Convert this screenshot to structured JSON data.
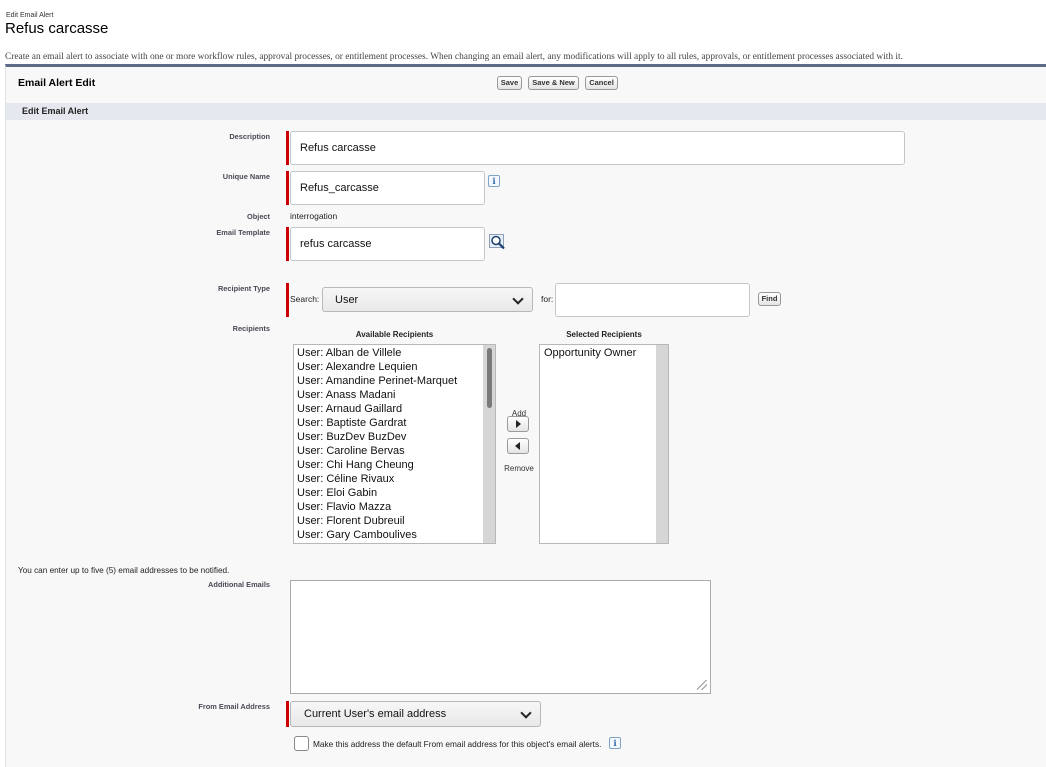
{
  "header": {
    "breadcrumb": "Edit Email Alert",
    "title": "Refus carcasse",
    "description": "Create an email alert to associate with one or more workflow rules, approval processes, or entitlement processes. When changing an email alert, any modifications will apply to all rules, approvals, or entitlement processes associated with it."
  },
  "panel": {
    "title": "Email Alert Edit",
    "buttons": {
      "save": "Save",
      "save_new": "Save & New",
      "cancel": "Cancel"
    },
    "section_title": "Edit Email Alert"
  },
  "form": {
    "description": {
      "label": "Description",
      "value": "Refus carcasse"
    },
    "unique_name": {
      "label": "Unique Name",
      "value": "Refus_carcasse",
      "info": "i"
    },
    "object": {
      "label": "Object",
      "value": "interrogation"
    },
    "email_template": {
      "label": "Email Template",
      "value": "refus carcasse"
    },
    "recipient_type": {
      "label": "Recipient Type",
      "search_label": "Search:",
      "search_value": "User",
      "for_label": "for:",
      "for_value": "",
      "find_button": "Find"
    },
    "recipients": {
      "label": "Recipients",
      "available_title": "Available Recipients",
      "selected_title": "Selected Recipients",
      "add_label": "Add",
      "remove_label": "Remove",
      "available": [
        "User: Alban de Villele",
        "User: Alexandre Lequien",
        "User: Amandine Perinet-Marquet",
        "User: Anass Madani",
        "User: Arnaud Gaillard",
        "User: Baptiste Gardrat",
        "User: BuzDev BuzDev",
        "User: Caroline Bervas",
        "User: Chi Hang Cheung",
        "User: Céline Rivaux",
        "User: Eloi Gabin",
        "User: Flavio Mazza",
        "User: Florent Dubreuil",
        "User: Gary Camboulives"
      ],
      "selected": [
        "Opportunity Owner"
      ]
    },
    "additional_emails": {
      "note": "You can enter up to five (5) email addresses to be notified.",
      "label": "Additional Emails",
      "value": ""
    },
    "from_email": {
      "label": "From Email Address",
      "value": "Current User's email address",
      "default_checkbox_label": "Make this address the default From email address for this object's email alerts.",
      "info": "i"
    }
  },
  "colors": {
    "required_bar": "#cc0000",
    "panel_border": "#5b6b85",
    "section_bg": "#e5e8ef"
  }
}
